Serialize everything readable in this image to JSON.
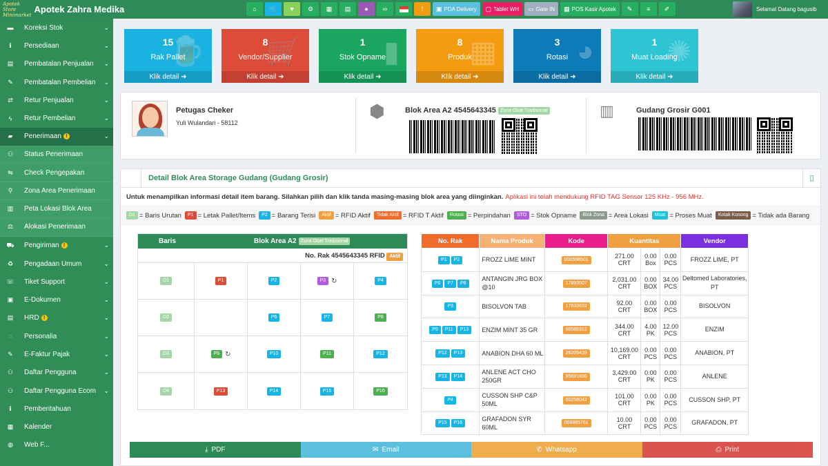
{
  "app": {
    "logo_text": "Apotek Store Minimarket",
    "title": "Apotek Zahra Medika",
    "welcome": "Selamat Datang bagusib"
  },
  "topnav": [
    {
      "name": "home-button",
      "icon": "⌂",
      "label": "",
      "color": "#27ae60"
    },
    {
      "name": "cart-button",
      "icon": "🛒",
      "label": "",
      "color": "#17b4e6"
    },
    {
      "name": "favorite-button",
      "icon": "♥",
      "label": "",
      "color": "#8bd05a"
    },
    {
      "name": "network-button",
      "icon": "⚙",
      "label": "",
      "color": "#27ae60"
    },
    {
      "name": "calculator-button",
      "icon": "▦",
      "label": "",
      "color": "#27ae60"
    },
    {
      "name": "calendar-button",
      "icon": "▤",
      "label": "",
      "color": "#27ae60"
    },
    {
      "name": "chat-button",
      "icon": "●",
      "label": "",
      "color": "#9b59b6"
    },
    {
      "name": "link-button",
      "icon": "∞",
      "label": "",
      "color": "#27ae60"
    },
    {
      "name": "language-button",
      "icon": "",
      "label": "",
      "color": "#27ae60"
    },
    {
      "name": "alert-button",
      "icon": "!",
      "label": "",
      "color": "#f39c12"
    },
    {
      "name": "pda-delivery-button",
      "icon": "▣",
      "label": "PDA Delivery",
      "color": "#5bc0de"
    },
    {
      "name": "tablet-wh-button",
      "icon": "▢",
      "label": "Tablet WH",
      "color": "#e91e63"
    },
    {
      "name": "gate-in-button",
      "icon": "▭",
      "label": "Gate IN",
      "color": "#a0aec0"
    },
    {
      "name": "pos-kasir-button",
      "icon": "▦",
      "label": "POS Kasir Apotek",
      "color": "#27ae60"
    },
    {
      "name": "tools-button",
      "icon": "✎",
      "label": "",
      "color": "#27ae60"
    },
    {
      "name": "list-button",
      "icon": "≡",
      "label": "",
      "color": "#27ae60"
    },
    {
      "name": "leaf-button",
      "icon": "✐",
      "label": "",
      "color": "#27ae60"
    }
  ],
  "sidebar": {
    "items": [
      {
        "label": "Koreksi Stok",
        "icon": "▬",
        "chev": "⌄"
      },
      {
        "label": "Persediaan",
        "icon": "ℹ",
        "chev": "⌄"
      },
      {
        "label": "Pembatalan Penjualan",
        "icon": "▤",
        "chev": "⌄"
      },
      {
        "label": "Pembatalan Pembelian",
        "icon": "✎",
        "chev": "⌄"
      },
      {
        "label": "Retur Penjualan",
        "icon": "⇄",
        "chev": "⌄"
      },
      {
        "label": "Retur Pembelian",
        "icon": "ϟ",
        "chev": "⌄"
      }
    ],
    "active": {
      "label": "Penerimaan",
      "icon": "▰",
      "chev": "⌄"
    },
    "sub_items": [
      {
        "label": "Status Penerimaan",
        "icon": "⚇"
      },
      {
        "label": "Check Pengepakan",
        "icon": "⇋"
      },
      {
        "label": "Zona Area Penerimaan",
        "icon": "⚲"
      },
      {
        "label": "Peta Lokasi Blok Area",
        "icon": "▥"
      },
      {
        "label": "Alokasi Penerimaan",
        "icon": "⚖"
      }
    ],
    "items2": [
      {
        "label": "Pengiriman",
        "icon": "⛟",
        "chev": "⌄",
        "warn": true
      },
      {
        "label": "Pengadaan Umum",
        "icon": "♻",
        "chev": "⌄",
        "warn": false
      },
      {
        "label": "Tiket Support",
        "icon": "☏",
        "chev": "⌄",
        "warn": false
      },
      {
        "label": "E-Dokumen",
        "icon": "▣",
        "chev": "⌄",
        "warn": false
      },
      {
        "label": "HRD",
        "icon": "▤",
        "chev": "⌄",
        "warn": true
      },
      {
        "label": "Personalia",
        "icon": "◌",
        "chev": "⌄",
        "warn": false
      },
      {
        "label": "E-Faktur Pajak",
        "icon": "✎",
        "chev": "⌄",
        "warn": false
      },
      {
        "label": "Daftar Pengguna",
        "icon": "⚇",
        "chev": "⌄",
        "warn": false
      },
      {
        "label": "Daftar Pengguna Ecom",
        "icon": "⚇",
        "chev": "⌄",
        "warn": false
      },
      {
        "label": "Pemberitahuan",
        "icon": "ℹ",
        "chev": "",
        "warn": false
      },
      {
        "label": "Kalender",
        "icon": "▦",
        "chev": "",
        "warn": false
      },
      {
        "label": "Web F...",
        "icon": "◍",
        "chev": "",
        "warn": false
      }
    ]
  },
  "tiles": [
    {
      "num": "15",
      "label": "Rak Pallet",
      "foot": "Klik detail ➜",
      "color": "#1ab2e0",
      "icon": "🍺"
    },
    {
      "num": "8",
      "label": "Vendor/Supplier",
      "foot": "Klik detail ➜",
      "color": "#dd4b39",
      "icon": "🛒"
    },
    {
      "num": "1",
      "label": "Stok Opname",
      "foot": "Klik detail ➜",
      "color": "#1aa660",
      "icon": "▮"
    },
    {
      "num": "8",
      "label": "Produk",
      "foot": "Klik detail ➜",
      "color": "#f39c12",
      "icon": "▦"
    },
    {
      "num": "3",
      "label": "Rotasi",
      "foot": "Klik detail ➜",
      "color": "#0c7bb8",
      "icon": "◕"
    },
    {
      "num": "1",
      "label": "Muat Loading",
      "foot": "Klik detail ➜",
      "color": "#2ec4d4",
      "icon": "✺"
    }
  ],
  "info": {
    "checker_title": "Petugas Cheker",
    "checker_name": "Yuli Wulandari - 58112",
    "blok_title": "Blok Area A2 4545643345",
    "blok_zone": "Zona Obat Tradisional",
    "gudang_title": "Gudang Grosir G001"
  },
  "detail": {
    "title": "Detail Blok Area Storage Gudang (Gudang Grosir)",
    "instruction": "Untuk menampilkan informasi detail item barang. Silahkan pilih dan klik tanda masing-masing blok area yang diinginkan.",
    "instruction_red": "Aplikasi ini telah mendukung RFID TAG Sensor 125 KHz - 956 MHz.",
    "legend": [
      {
        "badge": "D1",
        "cls": "c-lg",
        "text": "= Baris Urutan"
      },
      {
        "badge": "P1",
        "cls": "c-red",
        "text": "= Letak Pallet/Items"
      },
      {
        "badge": "P2",
        "cls": "c-blue",
        "text": "= Barang Terisi"
      },
      {
        "badge": "Aktif",
        "cls": "c-orange",
        "text": "= RFID Aktif"
      },
      {
        "badge": "Tidak Aktif",
        "cls": "c-dorange",
        "text": "= RFID T Aktif"
      },
      {
        "badge": "Rotasi",
        "cls": "c-green",
        "text": "= Perpindahan"
      },
      {
        "badge": "STO",
        "cls": "c-purple",
        "text": "= Stok Opname"
      },
      {
        "badge": "Blok Zona",
        "cls": "c-grey",
        "text": "= Area Lokasi"
      },
      {
        "badge": "Muat",
        "cls": "c-teal",
        "text": "= Proses Muat"
      },
      {
        "badge": "Kotak Kosong",
        "cls": "c-brown",
        "text": "= Tidak ada Barang"
      }
    ]
  },
  "rack": {
    "head_baris": "Baris",
    "head_blok": "Blok Area A2",
    "head_zone": "Zona Obat Tradisional",
    "rak_label": "No. Rak 4545643345 RFID",
    "rfid_status": "Aktif",
    "rows": [
      [
        {
          "b": "D1",
          "c": "c-lg"
        },
        {
          "b": "P1",
          "c": "c-red"
        },
        {
          "b": "P2",
          "c": "c-blue"
        },
        {
          "b": "P3",
          "c": "c-purple",
          "sync": true
        },
        {
          "b": "P4",
          "c": "c-blue"
        }
      ],
      [
        {
          "b": "D2",
          "c": "c-lg"
        },
        {
          "b": "",
          "c": ""
        },
        {
          "b": "P6",
          "c": "c-blue"
        },
        {
          "b": "P7",
          "c": "c-blue"
        },
        {
          "b": "P8",
          "c": "c-green"
        }
      ],
      [
        {
          "b": "D3",
          "c": "c-lg"
        },
        {
          "b": "P9",
          "c": "c-green",
          "sync": true
        },
        {
          "b": "P10",
          "c": "c-blue"
        },
        {
          "b": "P11",
          "c": "c-green"
        },
        {
          "b": "P12",
          "c": "c-blue"
        }
      ],
      [
        {
          "b": "D4",
          "c": "c-lg"
        },
        {
          "b": "P13",
          "c": "c-red"
        },
        {
          "b": "P14",
          "c": "c-blue"
        },
        {
          "b": "P15",
          "c": "c-blue"
        },
        {
          "b": "P16",
          "c": "c-green"
        }
      ]
    ]
  },
  "items": {
    "headers": [
      {
        "label": "No. Rak",
        "color": "#f26b2a"
      },
      {
        "label": "Nama Produk",
        "color": "#f8b174"
      },
      {
        "label": "Kode",
        "color": "#e91e8c"
      },
      {
        "label": "Kuantitas",
        "color": "#f0a040"
      },
      {
        "label": "Vendor",
        "color": "#7b2fe0"
      }
    ],
    "rows": [
      {
        "rak": [
          "P1",
          "P2"
        ],
        "nama": "FROZZ LIME MINT",
        "kode": "000598501",
        "q": [
          [
            "271.00",
            "CRT"
          ],
          [
            "0.00",
            "Box"
          ],
          [
            "0.00",
            "PCS"
          ]
        ],
        "vendor": "FROZZ LIME, PT"
      },
      {
        "rak": [
          "P6",
          "P7",
          "P8"
        ],
        "nama": "ANTANGIN JRG BOX @10",
        "kode": "17893507",
        "q": [
          [
            "2,031.00",
            "CRT"
          ],
          [
            "0.00",
            "BOX"
          ],
          [
            "34.00",
            "PCS"
          ]
        ],
        "vendor": "Deltomed Laboratories, PT"
      },
      {
        "rak": [
          "P3"
        ],
        "nama": "BISOLVON TAB",
        "kode": "17633632",
        "q": [
          [
            "92.00",
            "CRT"
          ],
          [
            "0.00",
            "BOX"
          ],
          [
            "0.00",
            "PCS"
          ]
        ],
        "vendor": "BISOLVON"
      },
      {
        "rak": [
          "P9",
          "P11",
          "P13"
        ],
        "nama": "ENZIM MINT 35 GR",
        "kode": "00588312",
        "q": [
          [
            "344.00",
            "CRT"
          ],
          [
            "4.00",
            "PK"
          ],
          [
            "12.00",
            "PCS"
          ]
        ],
        "vendor": "ENZIM"
      },
      {
        "rak": [
          "P12",
          "P13"
        ],
        "nama": "ANABION DHA 60 ML",
        "kode": "26209439",
        "q": [
          [
            "10,169.00",
            "CRT"
          ],
          [
            "0.00",
            "PCS"
          ],
          [
            "0.00",
            "PCS"
          ]
        ],
        "vendor": "ANABION, PT"
      },
      {
        "rak": [
          "P13",
          "P14"
        ],
        "nama": "ANLENE ACT CHO 250GR",
        "kode": "95691836",
        "q": [
          [
            "3,429.00",
            "CRT"
          ],
          [
            "0.00",
            "PK"
          ],
          [
            "0.00",
            "PCS"
          ]
        ],
        "vendor": "ANLENE"
      },
      {
        "rak": [
          "P4"
        ],
        "nama": "CUSSON SHP C&P 50ML",
        "kode": "00258042",
        "q": [
          [
            "101.00",
            "CRT"
          ],
          [
            "0.00",
            "PK"
          ],
          [
            "0.00",
            "PCS"
          ]
        ],
        "vendor": "CUSSON SHP, PT"
      },
      {
        "rak": [
          "P15",
          "P16"
        ],
        "nama": "GRAFADON SYR 60ML",
        "kode": "008865761",
        "q": [
          [
            "10.00",
            "CRT"
          ],
          [
            "0.00",
            "PCS"
          ],
          [
            "0.00",
            "PCS"
          ]
        ],
        "vendor": "GRAFADON, PT"
      }
    ]
  },
  "actions": [
    {
      "label": "PDF",
      "icon": "⤓",
      "color": "#2e8b57",
      "name": "pdf-button",
      "iconname": "download-icon"
    },
    {
      "label": "Email",
      "icon": "✉",
      "color": "#5bc0de",
      "name": "email-button",
      "iconname": "envelope-icon"
    },
    {
      "label": "Whatsapp",
      "icon": "✆",
      "color": "#f0ad4e",
      "name": "whatsapp-button",
      "iconname": "whatsapp-icon"
    },
    {
      "label": "Print",
      "icon": "⎙",
      "color": "#d9534f",
      "name": "print-button",
      "iconname": "printer-icon"
    }
  ]
}
